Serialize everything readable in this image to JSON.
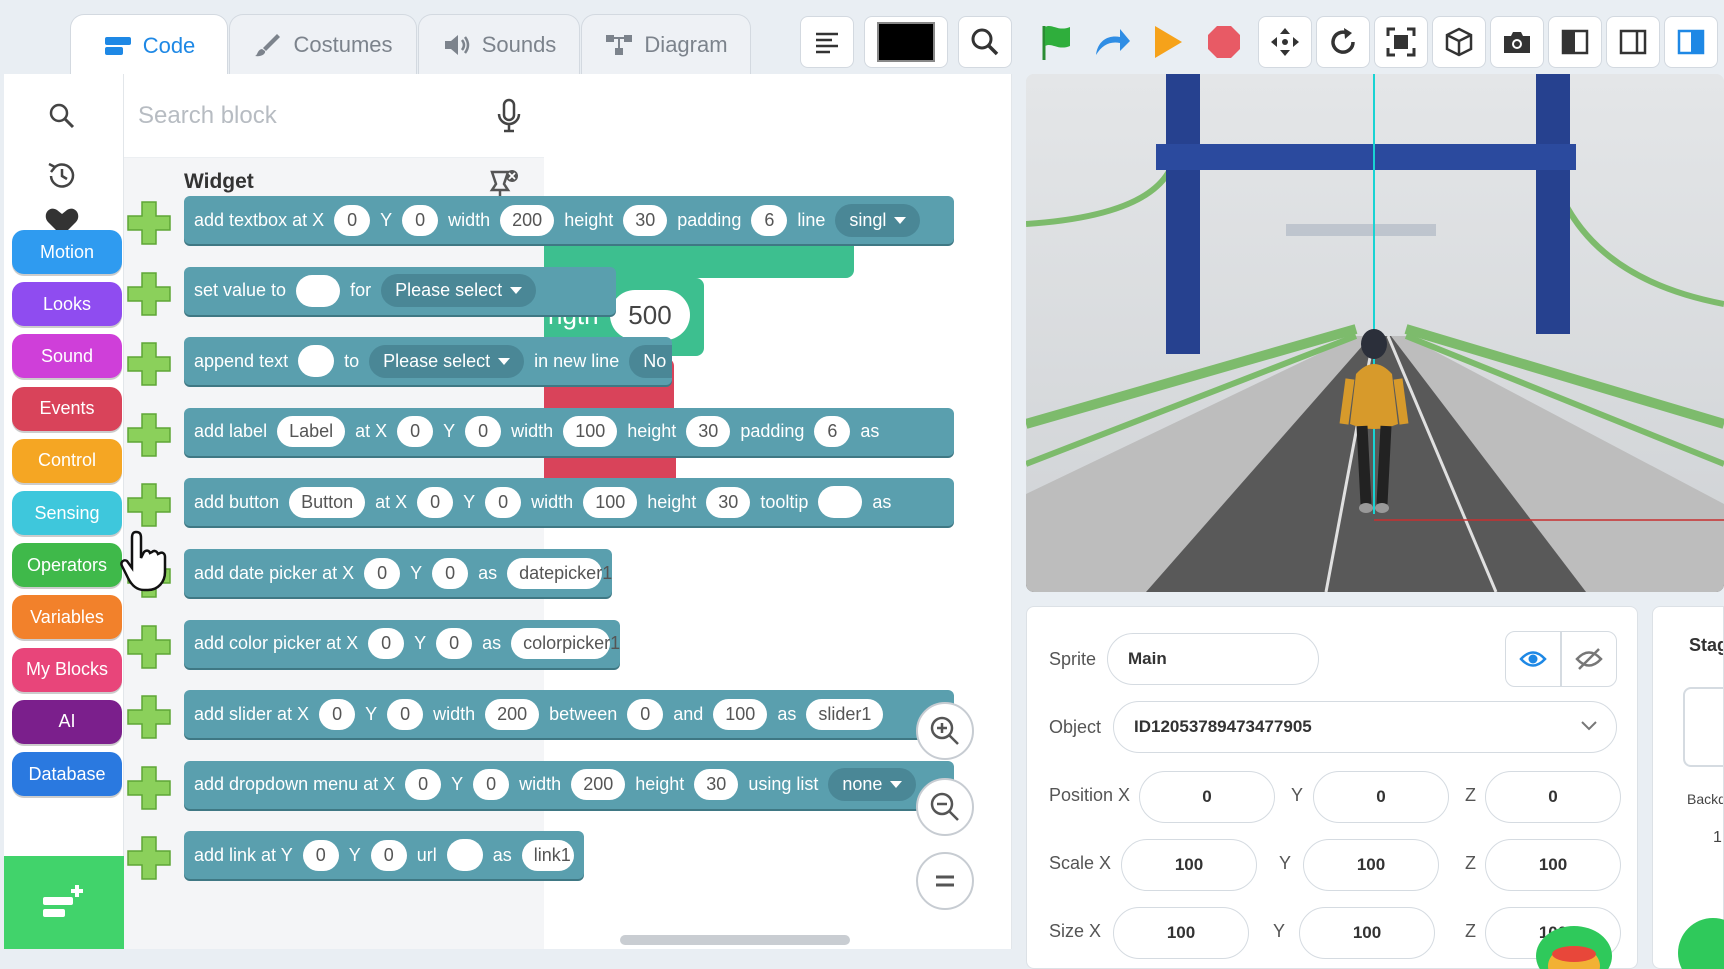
{
  "tabs": [
    {
      "label": "Code",
      "icon": "code-blocks-icon",
      "active": true
    },
    {
      "label": "Costumes",
      "icon": "brush-icon",
      "active": false
    },
    {
      "label": "Sounds",
      "icon": "speaker-icon",
      "active": false
    },
    {
      "label": "Diagram",
      "icon": "diagram-icon",
      "active": false
    }
  ],
  "toolbar": {
    "icons": [
      "align-icon",
      "color-swatch",
      "search-icon",
      "green-flag-icon",
      "redo-arrow-icon",
      "play-icon",
      "stop-icon",
      "move-arrows-icon",
      "rotate-icon",
      "fullscreen-icon",
      "cube-icon",
      "camera-icon",
      "layout-left-icon",
      "layout-right-icon",
      "layout-split-icon"
    ],
    "colors": {
      "flag": "#2fae3c",
      "play": "#f6a21a",
      "stop": "#e85a65",
      "accent": "#1e88e5"
    }
  },
  "categories": [
    {
      "label": "Motion",
      "color": "#2f9bf0"
    },
    {
      "label": "Looks",
      "color": "#8f4cf0"
    },
    {
      "label": "Sound",
      "color": "#cf3fd9"
    },
    {
      "label": "Events",
      "color": "#d9435a"
    },
    {
      "label": "Control",
      "color": "#f5a623"
    },
    {
      "label": "Sensing",
      "color": "#3ec7dc"
    },
    {
      "label": "Operators",
      "color": "#3fb94a"
    },
    {
      "label": "Variables",
      "color": "#f2812b"
    },
    {
      "label": "My Blocks",
      "color": "#e8457a"
    },
    {
      "label": "AI",
      "color": "#7b1f8c"
    },
    {
      "label": "Database",
      "color": "#2a79e0"
    }
  ],
  "palette": {
    "search_placeholder": "Search block",
    "section_title": "Widget"
  },
  "workspace": {
    "length_label": "ngth",
    "length_value": "500"
  },
  "blocks": [
    {
      "parts": [
        {
          "t": "text",
          "v": "add textbox at X"
        },
        {
          "t": "pill",
          "v": "0"
        },
        {
          "t": "text",
          "v": "Y"
        },
        {
          "t": "pill",
          "v": "0"
        },
        {
          "t": "text",
          "v": "width"
        },
        {
          "t": "pill",
          "v": "200"
        },
        {
          "t": "text",
          "v": "height"
        },
        {
          "t": "pill",
          "v": "30"
        },
        {
          "t": "text",
          "v": "padding"
        },
        {
          "t": "pill",
          "v": "6"
        },
        {
          "t": "text",
          "v": "line"
        },
        {
          "t": "dropdown",
          "v": "singl"
        }
      ]
    },
    {
      "parts": [
        {
          "t": "text",
          "v": "set value to"
        },
        {
          "t": "pill",
          "v": ""
        },
        {
          "t": "text",
          "v": "for"
        },
        {
          "t": "dropdown",
          "v": "Please select"
        }
      ]
    },
    {
      "parts": [
        {
          "t": "text",
          "v": "append text"
        },
        {
          "t": "pill",
          "v": ""
        },
        {
          "t": "text",
          "v": "to"
        },
        {
          "t": "dropdown",
          "v": "Please select"
        },
        {
          "t": "text",
          "v": "in new line"
        },
        {
          "t": "dropdown",
          "v": "No"
        }
      ]
    },
    {
      "parts": [
        {
          "t": "text",
          "v": "add label"
        },
        {
          "t": "pill",
          "v": "Label"
        },
        {
          "t": "text",
          "v": "at X"
        },
        {
          "t": "pill",
          "v": "0"
        },
        {
          "t": "text",
          "v": "Y"
        },
        {
          "t": "pill",
          "v": "0"
        },
        {
          "t": "text",
          "v": "width"
        },
        {
          "t": "pill",
          "v": "100"
        },
        {
          "t": "text",
          "v": "height"
        },
        {
          "t": "pill",
          "v": "30"
        },
        {
          "t": "text",
          "v": "padding"
        },
        {
          "t": "pill",
          "v": "6"
        },
        {
          "t": "text",
          "v": "as"
        }
      ]
    },
    {
      "parts": [
        {
          "t": "text",
          "v": "add button"
        },
        {
          "t": "pill",
          "v": "Button"
        },
        {
          "t": "text",
          "v": "at X"
        },
        {
          "t": "pill",
          "v": "0"
        },
        {
          "t": "text",
          "v": "Y"
        },
        {
          "t": "pill",
          "v": "0"
        },
        {
          "t": "text",
          "v": "width"
        },
        {
          "t": "pill",
          "v": "100"
        },
        {
          "t": "text",
          "v": "height"
        },
        {
          "t": "pill",
          "v": "30"
        },
        {
          "t": "text",
          "v": "tooltip"
        },
        {
          "t": "pill",
          "v": ""
        },
        {
          "t": "text",
          "v": "as"
        }
      ]
    },
    {
      "parts": [
        {
          "t": "text",
          "v": "add date picker at X"
        },
        {
          "t": "pill",
          "v": "0"
        },
        {
          "t": "text",
          "v": "Y"
        },
        {
          "t": "pill",
          "v": "0"
        },
        {
          "t": "text",
          "v": "as"
        },
        {
          "t": "pill",
          "v": "datepicker1"
        }
      ]
    },
    {
      "parts": [
        {
          "t": "text",
          "v": "add color picker at X"
        },
        {
          "t": "pill",
          "v": "0"
        },
        {
          "t": "text",
          "v": "Y"
        },
        {
          "t": "pill",
          "v": "0"
        },
        {
          "t": "text",
          "v": "as"
        },
        {
          "t": "pill",
          "v": "colorpicker1"
        }
      ]
    },
    {
      "parts": [
        {
          "t": "text",
          "v": "add slider at X"
        },
        {
          "t": "pill",
          "v": "0"
        },
        {
          "t": "text",
          "v": "Y"
        },
        {
          "t": "pill",
          "v": "0"
        },
        {
          "t": "text",
          "v": "width"
        },
        {
          "t": "pill",
          "v": "200"
        },
        {
          "t": "text",
          "v": "between"
        },
        {
          "t": "pill",
          "v": "0"
        },
        {
          "t": "text",
          "v": "and"
        },
        {
          "t": "pill",
          "v": "100"
        },
        {
          "t": "text",
          "v": "as"
        },
        {
          "t": "pill",
          "v": "slider1"
        }
      ]
    },
    {
      "parts": [
        {
          "t": "text",
          "v": "add dropdown menu at X"
        },
        {
          "t": "pill",
          "v": "0"
        },
        {
          "t": "text",
          "v": "Y"
        },
        {
          "t": "pill",
          "v": "0"
        },
        {
          "t": "text",
          "v": "width"
        },
        {
          "t": "pill",
          "v": "200"
        },
        {
          "t": "text",
          "v": "height"
        },
        {
          "t": "pill",
          "v": "30"
        },
        {
          "t": "text",
          "v": "using list"
        },
        {
          "t": "dropdown",
          "v": "none"
        }
      ]
    },
    {
      "parts": [
        {
          "t": "text",
          "v": "add link at Y"
        },
        {
          "t": "pill",
          "v": "0"
        },
        {
          "t": "text",
          "v": "Y"
        },
        {
          "t": "pill",
          "v": "0"
        },
        {
          "t": "text",
          "v": "url"
        },
        {
          "t": "pill",
          "v": ""
        },
        {
          "t": "text",
          "v": "as"
        },
        {
          "t": "pill",
          "v": "link1"
        }
      ]
    }
  ],
  "sprite_panel": {
    "sprite_label": "Sprite",
    "sprite_name": "Main",
    "object_label": "Object",
    "object_id": "ID12053789473477905",
    "position_label": "Position X",
    "scale_label": "Scale X",
    "size_label": "Size X",
    "y_label": "Y",
    "z_label": "Z",
    "position": {
      "x": "0",
      "y": "0",
      "z": "0"
    },
    "scale": {
      "x": "100",
      "y": "100",
      "z": "100"
    },
    "size": {
      "x": "100",
      "y": "100",
      "z": "100"
    }
  },
  "stage_panel": {
    "title": "Stag",
    "backdrops_label": "Backdr",
    "backdrops_count": "1"
  }
}
